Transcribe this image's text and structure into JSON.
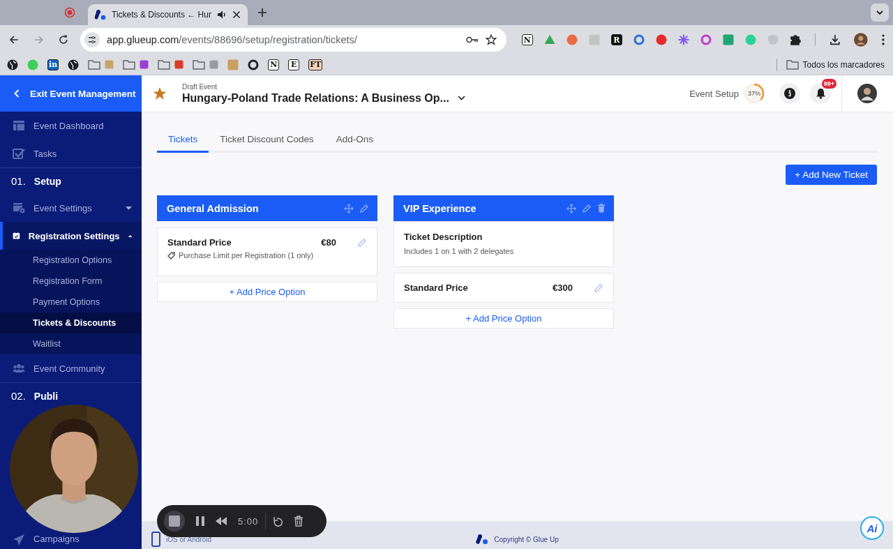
{
  "browser": {
    "tab_title": "Tickets & Discounts ← Hur",
    "url_host": "app.glueup.com",
    "url_path": "/events/88696/setup/registration/tickets/",
    "extensions": [
      {
        "kind": "letter",
        "text": "N",
        "color": "#ffffff"
      },
      {
        "kind": "triangle",
        "color": "#34a853"
      },
      {
        "kind": "dot",
        "color": "#ee6a45"
      },
      {
        "kind": "tile",
        "color": "#c4c4c6"
      },
      {
        "kind": "letter",
        "text": "R",
        "color": "#111111"
      },
      {
        "kind": "ring",
        "color": "#2a6fd6"
      },
      {
        "kind": "dot",
        "color": "#e52b2b"
      },
      {
        "kind": "burst",
        "color": "#7b5cf0"
      },
      {
        "kind": "ring",
        "color": "#c03ccf"
      },
      {
        "kind": "tile",
        "color": "#1fa672"
      },
      {
        "kind": "dot",
        "color": "#2bd39a"
      },
      {
        "kind": "shield",
        "color": "#c4c4c8"
      },
      {
        "kind": "puzzle",
        "color": "#222222"
      }
    ],
    "bookmarks": [
      {
        "kind": "globe",
        "color": "#202124"
      },
      {
        "kind": "dot",
        "color": "#3ecf5a"
      },
      {
        "kind": "letter",
        "text": "in",
        "color": "#0a66c2"
      },
      {
        "kind": "globe",
        "color": "#202124"
      },
      {
        "kind": "folder",
        "color": "#c8a46a"
      },
      {
        "kind": "folder",
        "color": "#9b3fd0"
      },
      {
        "kind": "folder",
        "color": "#d93b2b"
      },
      {
        "kind": "folder",
        "color": "#9a9aa0"
      },
      {
        "kind": "tile",
        "color": "#c8a060"
      },
      {
        "kind": "ring",
        "color": "#202124"
      },
      {
        "kind": "letter",
        "text": "N",
        "color": "#ffffff"
      },
      {
        "kind": "letter",
        "text": "E",
        "color": "#ffffff"
      },
      {
        "kind": "letter",
        "text": "FT",
        "color": "#f7d3bd"
      }
    ],
    "all_bookmarks": "Todos los marcadores"
  },
  "sidebar": {
    "exit_label": "Exit Event Management",
    "items": [
      {
        "kind": "dashboard",
        "label": "Event Dashboard",
        "selected": false
      },
      {
        "kind": "tasks",
        "label": "Tasks",
        "selected": false
      },
      {
        "kind": "section",
        "number": "01.",
        "label": "Setup"
      },
      {
        "kind": "settings",
        "label": "Event Settings",
        "selected": false,
        "expanded": false
      },
      {
        "kind": "registration",
        "label": "Registration Settings",
        "selected": true,
        "expanded": true,
        "children": [
          {
            "label": "Registration Options",
            "selected": false
          },
          {
            "label": "Registration Form",
            "selected": false
          },
          {
            "label": "Payment Options",
            "selected": false
          },
          {
            "label": "Tickets & Discounts",
            "selected": true
          },
          {
            "label": "Waitlist",
            "selected": false
          }
        ]
      },
      {
        "kind": "community",
        "label": "Event Community",
        "selected": false
      },
      {
        "kind": "section",
        "number": "02.",
        "label": "Publi"
      },
      {
        "kind": "campaigns",
        "label": "Campaigns",
        "selected": false
      }
    ]
  },
  "header": {
    "status": "Draft Event",
    "title": "Hungary-Poland Trade Relations: A Business Op...",
    "setup_label": "Event Setup",
    "setup_progress": {
      "text": "37%",
      "level": 0.37
    },
    "notification_badge": "99+"
  },
  "tabs": [
    {
      "label": "Tickets",
      "selected": true
    },
    {
      "label": "Ticket Discount Codes",
      "selected": false
    },
    {
      "label": "Add-Ons",
      "selected": false
    }
  ],
  "add_ticket_label": "+ Add New Ticket",
  "tickets": [
    {
      "name": "General Admission",
      "deletable": false,
      "prices": [
        {
          "label": "Standard Price",
          "amount": "€80",
          "note": "Purchase Limit per Registration (1 only)"
        }
      ],
      "add_price_label": "+ Add Price Option"
    },
    {
      "name": "VIP Experience",
      "deletable": true,
      "description": {
        "title": "Ticket Description",
        "text": "Includes 1 on 1 with 2 delegates"
      },
      "prices": [
        {
          "label": "Standard Price",
          "amount": "€300"
        }
      ],
      "add_price_label": "+ Add Price Option"
    }
  ],
  "footer": {
    "app_hint": "iOS or Android",
    "copyright": "Copyright © Glue Up",
    "assistant": "Ai"
  },
  "recorder": {
    "time": "5:00"
  }
}
